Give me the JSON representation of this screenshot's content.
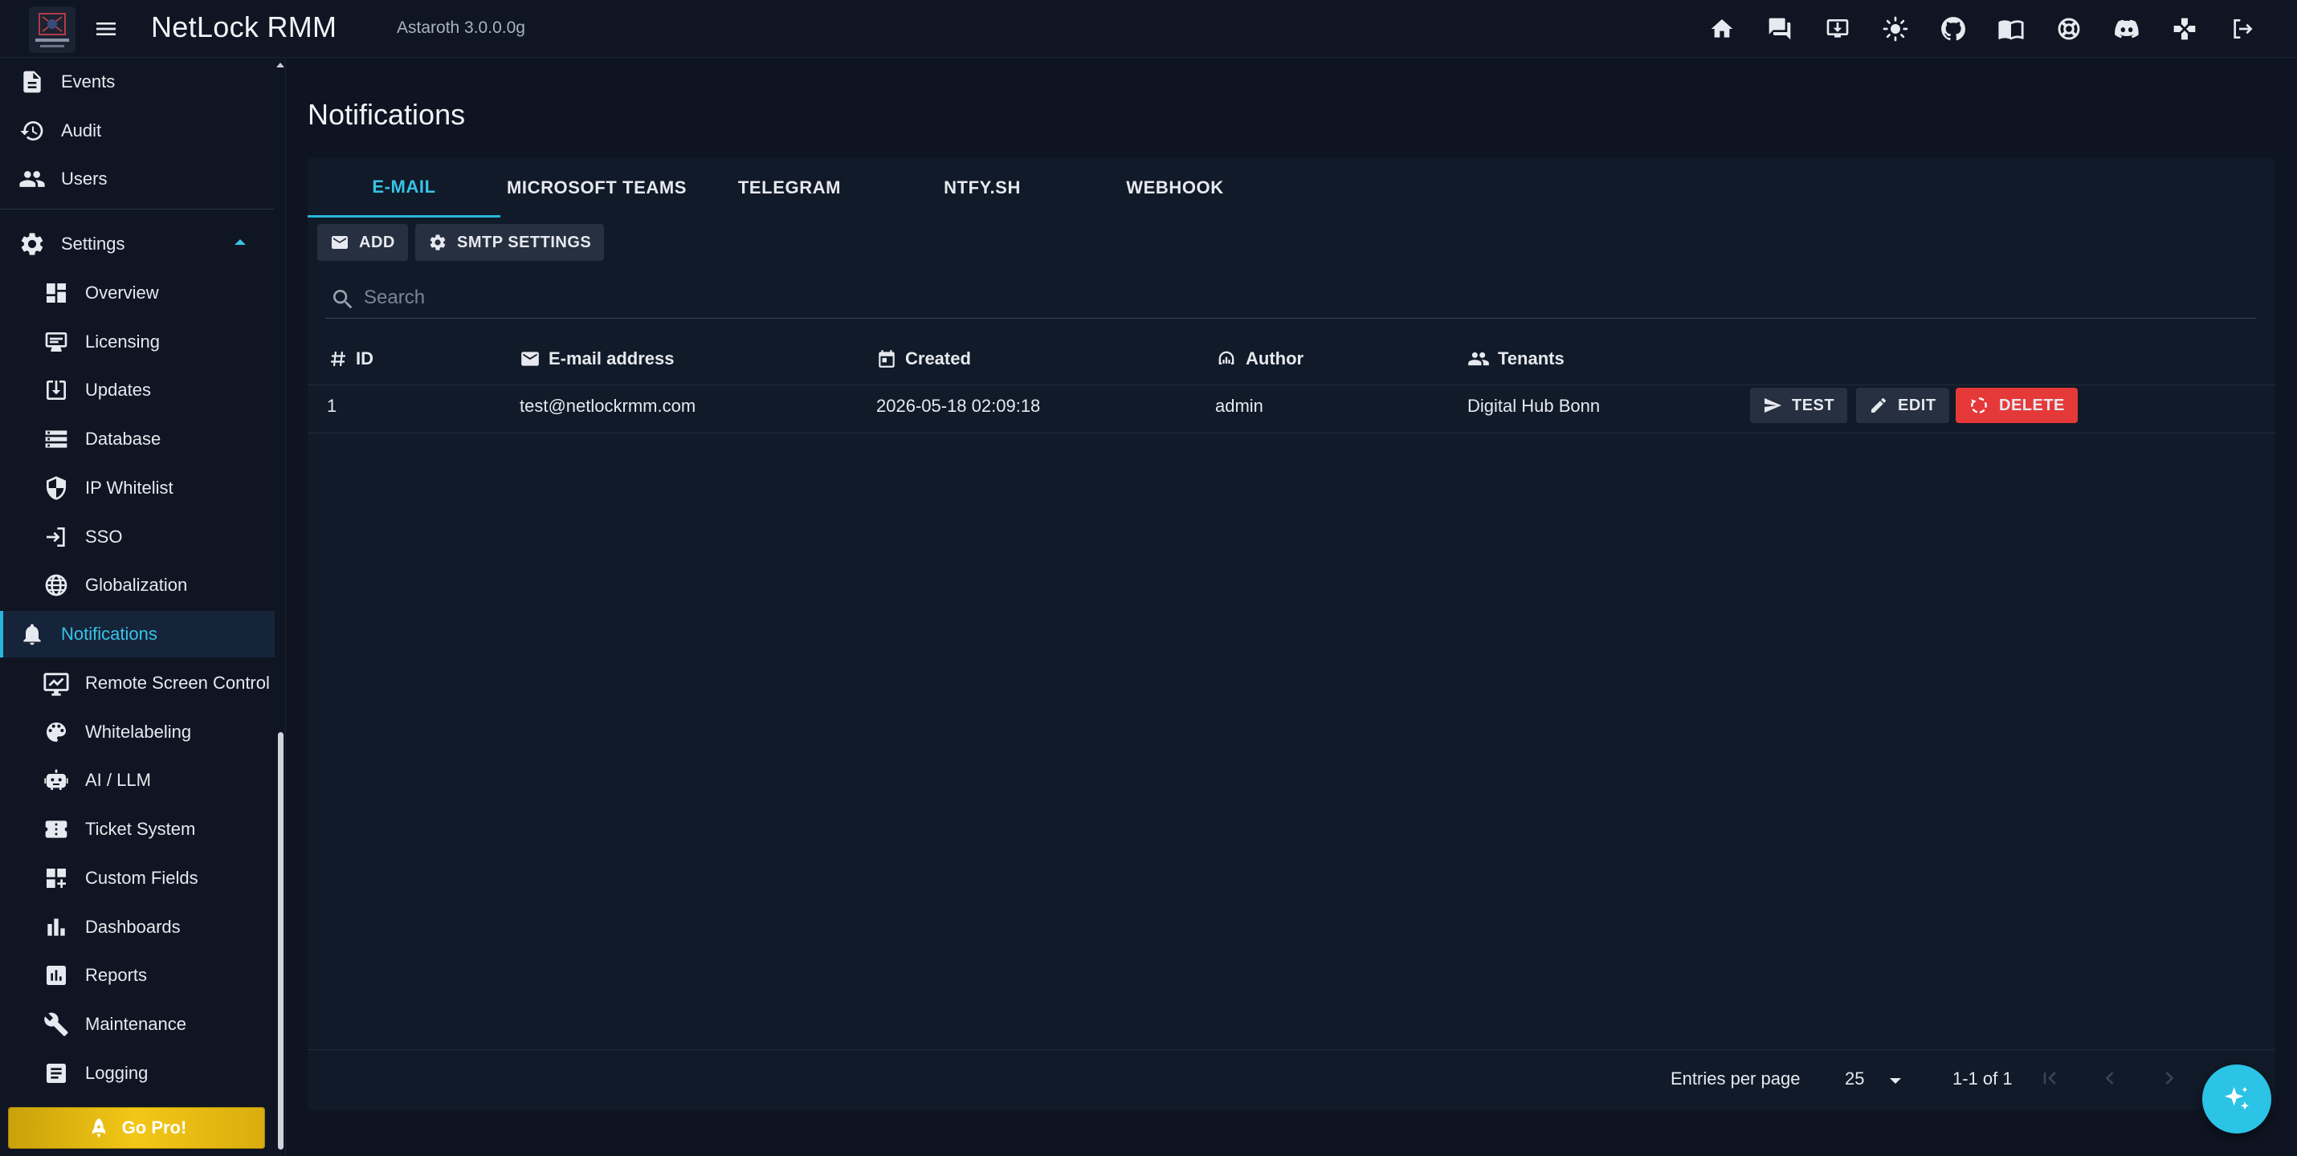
{
  "app": {
    "title": "NetLock RMM",
    "version": "Astaroth 3.0.0.0g"
  },
  "topbar_icons": [
    "home-icon",
    "chat-icon",
    "download-icon",
    "theme-sun-icon",
    "github-icon",
    "docs-book-icon",
    "support-lifebuoy-icon",
    "discord-icon",
    "gamepad-icon",
    "logout-icon"
  ],
  "sidebar": {
    "items_top": [
      {
        "label": "Events",
        "icon": "events-document-icon"
      },
      {
        "label": "Audit",
        "icon": "audit-history-icon"
      },
      {
        "label": "Users",
        "icon": "users-group-icon"
      }
    ],
    "settings_label": "Settings",
    "settings_items": [
      {
        "label": "Overview",
        "icon": "dashboard-grid-icon"
      },
      {
        "label": "Licensing",
        "icon": "licensing-card-icon"
      },
      {
        "label": "Updates",
        "icon": "updates-download-icon"
      },
      {
        "label": "Database",
        "icon": "database-icon"
      },
      {
        "label": "IP Whitelist",
        "icon": "shield-icon"
      },
      {
        "label": "SSO",
        "icon": "login-arrow-icon"
      },
      {
        "label": "Globalization",
        "icon": "globe-icon"
      }
    ],
    "active_item": {
      "label": "Notifications",
      "icon": "bell-icon"
    },
    "settings_items_after": [
      {
        "label": "Remote Screen Control",
        "icon": "remote-screen-icon"
      },
      {
        "label": "Whitelabeling",
        "icon": "palette-icon"
      },
      {
        "label": "AI / LLM",
        "icon": "robot-icon"
      },
      {
        "label": "Ticket System",
        "icon": "ticket-icon"
      },
      {
        "label": "Custom Fields",
        "icon": "custom-fields-icon"
      },
      {
        "label": "Dashboards",
        "icon": "bar-chart-icon"
      },
      {
        "label": "Reports",
        "icon": "report-chart-icon"
      },
      {
        "label": "Maintenance",
        "icon": "wrench-icon"
      },
      {
        "label": "Logging",
        "icon": "logging-list-icon"
      }
    ],
    "go_pro_label": "Go Pro!"
  },
  "main": {
    "page_title": "Notifications",
    "tabs": [
      "E-MAIL",
      "MICROSOFT TEAMS",
      "TELEGRAM",
      "NTFY.SH",
      "WEBHOOK"
    ],
    "active_tab": "E-MAIL",
    "toolbar": {
      "add_label": "ADD",
      "smtp_label": "SMTP SETTINGS"
    },
    "search": {
      "placeholder": "Search",
      "value": ""
    },
    "table": {
      "columns": [
        "ID",
        "E-mail address",
        "Created",
        "Author",
        "Tenants"
      ],
      "rows": [
        {
          "id": "1",
          "email": "test@netlockrmm.com",
          "created": "2026-05-18 02:09:18",
          "author": "admin",
          "tenants": "Digital Hub Bonn"
        }
      ],
      "row_actions": {
        "test": "TEST",
        "edit": "EDIT",
        "delete": "DELETE"
      }
    },
    "pager": {
      "entries_label": "Entries per page",
      "per_page": "25",
      "range": "1-1 of 1"
    }
  },
  "colors": {
    "accent": "#29b6d8",
    "danger": "#e53939",
    "background": "#0e1421",
    "panel": "#111a28",
    "gold": "#f3c717"
  }
}
